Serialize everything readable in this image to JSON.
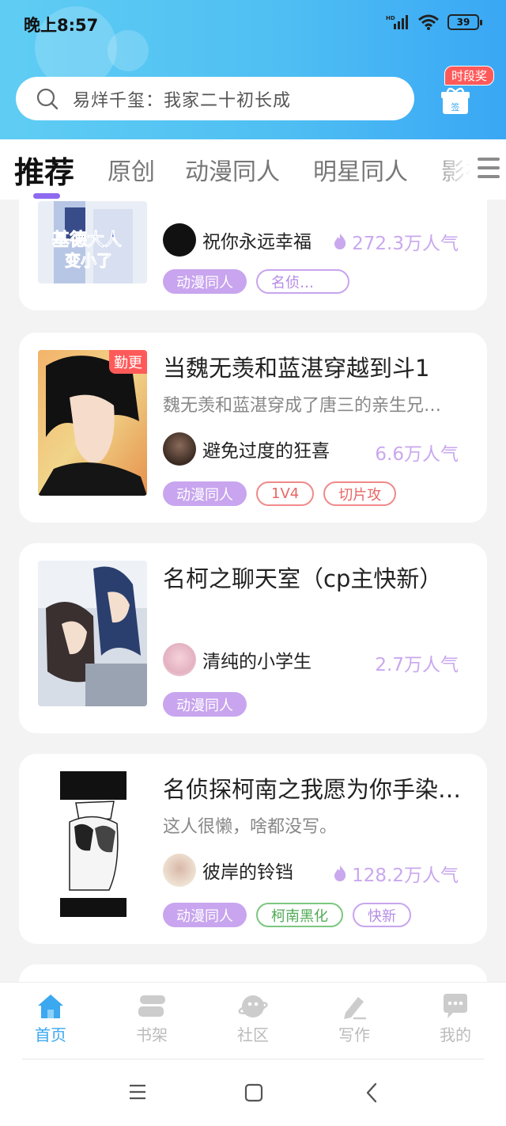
{
  "status_bar": {
    "time": "晚上8:57",
    "battery": "39"
  },
  "search": {
    "placeholder": "易烊千玺：我家二十初长成"
  },
  "gift": {
    "badge": "时段奖",
    "box_text": "签"
  },
  "tabs": [
    {
      "label": "推荐",
      "active": true
    },
    {
      "label": "原创"
    },
    {
      "label": "动漫同人"
    },
    {
      "label": "明星同人"
    },
    {
      "label": "影视"
    }
  ],
  "cards": [
    {
      "author": "祝你永远幸福",
      "popularity": "272.3万人气",
      "hot": true,
      "tags": [
        {
          "label": "动漫同人"
        },
        {
          "label": "名侦…"
        }
      ]
    },
    {
      "title": "当魏无羡和蓝湛穿越到斗1",
      "description": "魏无羡和蓝湛穿成了唐三的亲生兄…",
      "badge": "勤更",
      "author": "避免过度的狂喜",
      "popularity": "6.6万人气",
      "hot": false,
      "tags": [
        {
          "label": "动漫同人"
        },
        {
          "label": "1V4"
        },
        {
          "label": "切片攻"
        }
      ]
    },
    {
      "title": "名柯之聊天室（cp主快新）",
      "description": "",
      "author": "清纯的小学生",
      "popularity": "2.7万人气",
      "hot": false,
      "tags": [
        {
          "label": "动漫同人"
        }
      ]
    },
    {
      "title": "名侦探柯南之我愿为你手染…",
      "description": "这人很懒，啥都没写。",
      "author": "彼岸的铃铛",
      "popularity": "128.2万人气",
      "hot": true,
      "tags": [
        {
          "label": "动漫同人"
        },
        {
          "label": "柯南黑化"
        },
        {
          "label": "快新"
        }
      ]
    }
  ],
  "bottom_nav": [
    {
      "label": "首页",
      "icon": "home-icon",
      "active": true
    },
    {
      "label": "书架",
      "icon": "bookshelf-icon"
    },
    {
      "label": "社区",
      "icon": "community-icon"
    },
    {
      "label": "写作",
      "icon": "write-icon"
    },
    {
      "label": "我的",
      "icon": "profile-icon"
    }
  ],
  "colors": {
    "accent": "#3ba8f0",
    "tag_purple": "#c8a5ee",
    "popularity": "#c9a8ee",
    "badge_red": "#ff5a5a"
  }
}
